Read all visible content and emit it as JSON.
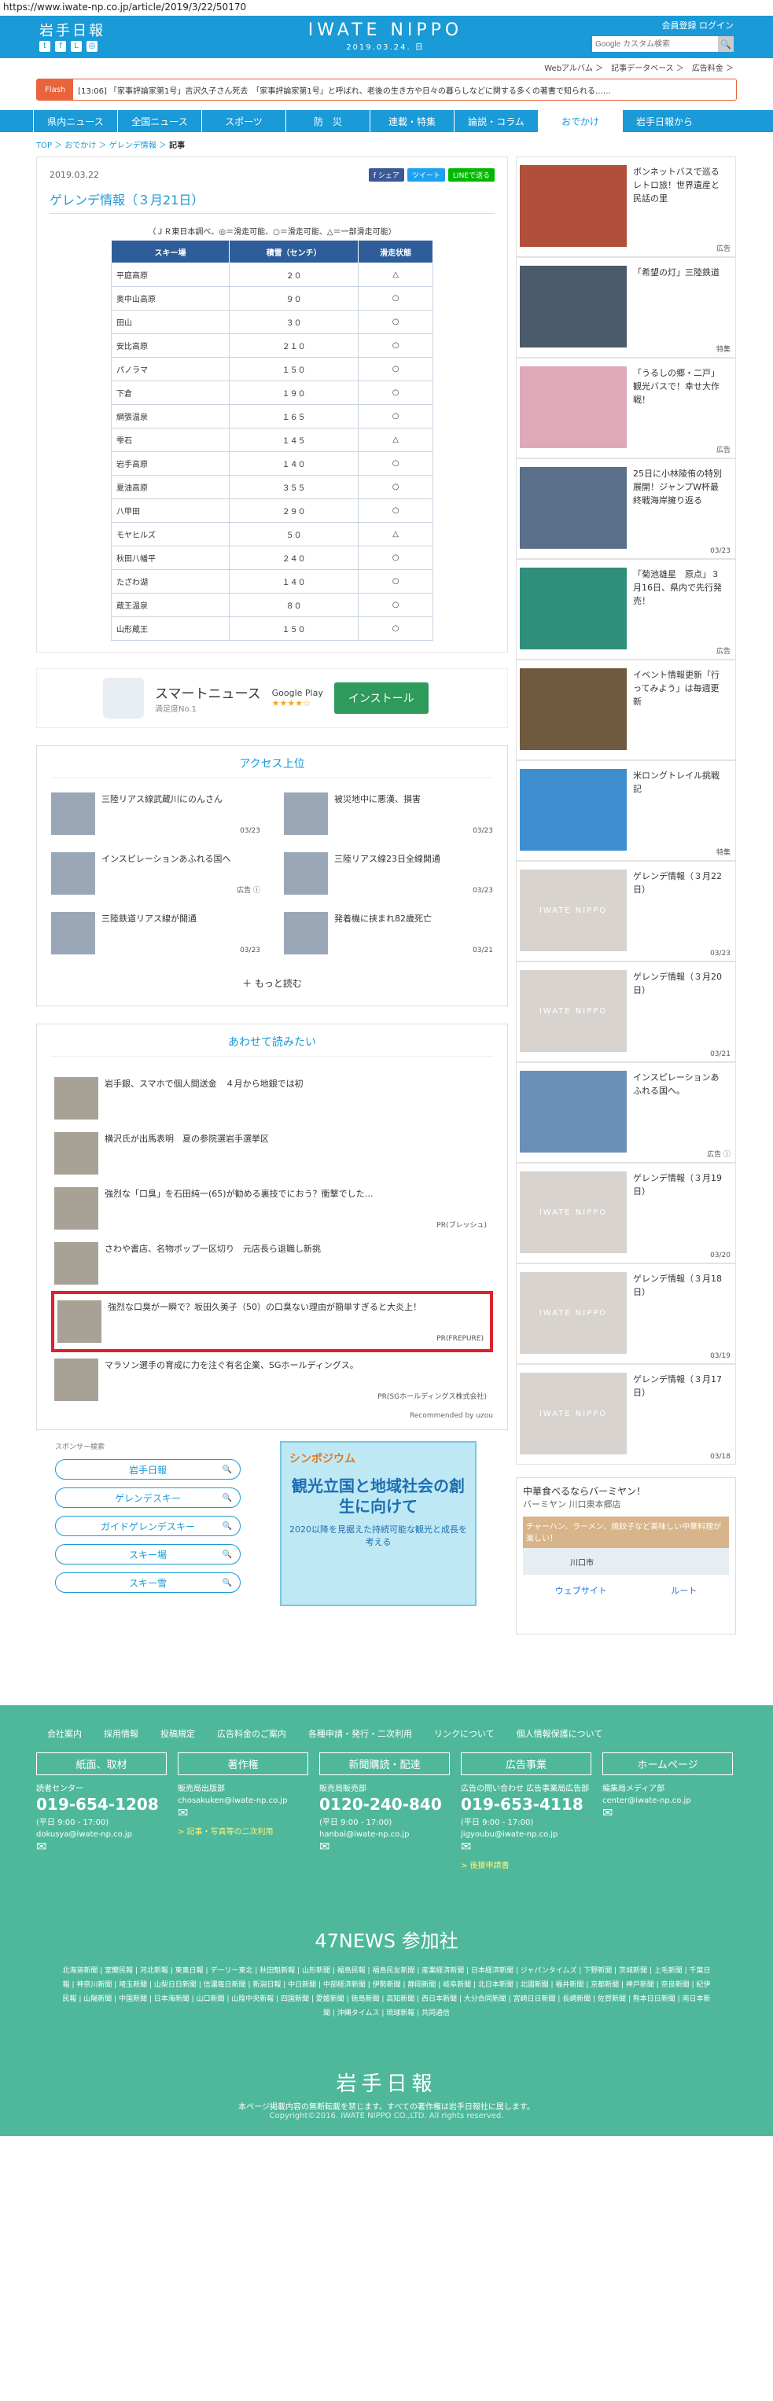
{
  "url": "https://www.iwate-np.co.jp/article/2019/3/22/50170",
  "header": {
    "logo": "岩手日報",
    "brand": "IWATE NIPPO",
    "date": "2019.03.24. 日",
    "links": "会員登録  ログイン",
    "search_placeholder": "Google カスタム検索",
    "search_btn": "🔍",
    "subbar": "Webアルバム ＞　記事データベース ＞　広告料金 ＞"
  },
  "flash": {
    "tag": "Flash",
    "text": "[13:06] 「家事評論家第1号」吉沢久子さん死去　「家事評論家第1号」と呼ばれ、老後の生き方や日々の暮らしなどに関する多くの著書で知られる……"
  },
  "nav": [
    "県内ニュース",
    "全国ニュース",
    "スポーツ",
    "防　災",
    "連載・特集",
    "論説・コラム",
    "おでかけ",
    "岩手日報から"
  ],
  "breadcrumb": {
    "items": "TOP ＞ おでかけ ＞ ゲレンデ情報 ＞",
    "current": "記事"
  },
  "article": {
    "date": "2019.03.22",
    "share": [
      "f シェア",
      "ツイート",
      "LINEで送る"
    ],
    "title": "ゲレンデ情報（３月21日）",
    "note": "（ＪＲ東日本調べ、◎＝滑走可能、○＝滑走可能、△＝一部滑走可能）",
    "table_headers": [
      "スキー場",
      "積雪（センチ）",
      "滑走状態"
    ],
    "rows": [
      [
        "平庭高原",
        "２０",
        "△"
      ],
      [
        "奥中山高原",
        "９０",
        "○"
      ],
      [
        "田山",
        "３０",
        "○"
      ],
      [
        "安比高原",
        "２１０",
        "○"
      ],
      [
        "パノラマ",
        "１５０",
        "○"
      ],
      [
        "下倉",
        "１９０",
        "○"
      ],
      [
        "網張温泉",
        "１６５",
        "○"
      ],
      [
        "雫石",
        "１４５",
        "△"
      ],
      [
        "岩手高原",
        "１４０",
        "○"
      ],
      [
        "夏油高原",
        "３５５",
        "○"
      ],
      [
        "八甲田",
        "２９０",
        "○"
      ],
      [
        "モヤヒルズ",
        "５０",
        "△"
      ],
      [
        "秋田八幡平",
        "２４０",
        "○"
      ],
      [
        "たざわ湖",
        "１４０",
        "○"
      ],
      [
        "蔵王温泉",
        "８０",
        "○"
      ],
      [
        "山形蔵王",
        "１５０",
        "○"
      ]
    ]
  },
  "app_ad": {
    "name": "スマートニュース",
    "sub": "満足度No.1",
    "store": "Google Play",
    "stars": "★★★★☆",
    "install": "インストール"
  },
  "access": {
    "title": "アクセス上位",
    "items": [
      {
        "title": "三陸リアス線武蔵川にのんさん",
        "date": "03/23"
      },
      {
        "title": "被災地中に悪漢、損害",
        "date": "03/23"
      },
      {
        "title": "インスピレーションあふれる国へ",
        "date": "広告 ⓘ"
      },
      {
        "title": "三陸リアス線23日全線開通",
        "date": "03/23"
      },
      {
        "title": "三陸鉄道リアス線が開通",
        "date": "03/23"
      },
      {
        "title": "発着機に挟まれ82歳死亡",
        "date": "03/21"
      }
    ],
    "more": "＋ もっと読む"
  },
  "related": {
    "title": "あわせて読みたい",
    "items": [
      {
        "title": "岩手銀、スマホで個人間送金　４月から地銀では初",
        "pr": ""
      },
      {
        "title": "横沢氏が出馬表明　夏の参院選岩手選挙区",
        "pr": ""
      },
      {
        "title": "強烈な「口臭」を石田純一(65)が勧める裏技でにおう？衝撃でした…",
        "pr": "PR(ブレッシュ)"
      },
      {
        "title": "さわや書店、名物ポップ一区切り　元店長ら退職し新挑",
        "pr": ""
      },
      {
        "title": "強烈な口臭が一瞬で？坂田久美子（50）の口臭ない理由が簡単すぎると大炎上！",
        "pr": "PR(FREPURE)"
      },
      {
        "title": "マラソン選手の育成に力を注ぐ有名企業、SGホールディングス。",
        "pr": "PR(SGホールディングス株式会社)"
      }
    ],
    "recby": "Recommended by uzou"
  },
  "sponsor": {
    "label": "スポンサー検索",
    "items": [
      "岩手日報",
      "ゲレンデスキー",
      "ガイドゲレンデスキー",
      "スキー場",
      "スキー雪"
    ]
  },
  "banner": {
    "top": "シンポジウム",
    "main": "観光立国と地域社会の創生に向けて",
    "sub": "2020以降を見据えた持続可能な観光と成長を考える"
  },
  "side": [
    {
      "title": "ボンネットバスで巡るレトロ旅！世界遺産と民話の里",
      "date": "広告",
      "np": false
    },
    {
      "title": "「希望の灯」三陸鉄道",
      "date": "特集",
      "np": false
    },
    {
      "title": "「うるしの郷・二戸」観光バスで！幸せ大作戦！",
      "date": "広告",
      "np": false
    },
    {
      "title": "25日に小林陵侑の特別展開！ジャンプW杯最終戦海岸擁り返る",
      "date": "03/23",
      "np": false
    },
    {
      "title": "「菊池雄星　原点」３月16日、県内で先行発売！",
      "date": "広告",
      "np": false
    },
    {
      "title": "イベント情報更新「行ってみよう」は毎週更新",
      "date": "",
      "np": false
    },
    {
      "title": "米ロングトレイル挑戦記",
      "date": "特集",
      "np": false
    },
    {
      "title": "ゲレンデ情報（３月22日）",
      "date": "03/23",
      "np": true
    },
    {
      "title": "ゲレンデ情報（３月20日）",
      "date": "03/21",
      "np": true
    },
    {
      "title": "インスピレーションあふれる国へ。",
      "date": "広告 ⓘ",
      "np": false
    },
    {
      "title": "ゲレンデ情報（３月19日）",
      "date": "03/20",
      "np": true
    },
    {
      "title": "ゲレンデ情報（３月18日）",
      "date": "03/19",
      "np": true
    },
    {
      "title": "ゲレンデ情報（３月17日）",
      "date": "03/18",
      "np": true
    }
  ],
  "np_placeholder": "IWATE NIPPO",
  "map_ad": {
    "head": "中華食べるならバーミヤン！",
    "sub": "バーミヤン 川口東本郷店",
    "pic": "チャーハン、ラーメン、焼餃子など美味しい中華料理が楽しい！",
    "map": "川口市",
    "route1": "ウェブサイト",
    "route2": "ルート"
  },
  "footer": {
    "links": [
      "会社案内",
      "採用情報",
      "投稿規定",
      "広告料金のご案内",
      "各種申請・発行・二次利用",
      "リンクについて",
      "個人情報保護について"
    ],
    "cols": [
      {
        "head": "紙面、取材",
        "l1": "読者センター",
        "tel": "019-654-1208",
        "l2": "(平日 9:00 - 17:00)",
        "mail": "dokusya@iwate-np.co.jp",
        "lnk": ""
      },
      {
        "head": "著作権",
        "l1": "販売局出版部",
        "tel": "",
        "l2": "",
        "mail": "chosakuken@iwate-np.co.jp",
        "lnk": "> 記事・写真等の二次利用"
      },
      {
        "head": "新聞購読・配達",
        "l1": "販売局販売部",
        "tel": "0120-240-840",
        "l2": "(平日 9:00 - 17:00)",
        "mail": "hanbai@iwate-np.co.jp",
        "lnk": ""
      },
      {
        "head": "広告事業",
        "l1": "広告の問い合わせ 広告事業局広告部",
        "tel": "019-653-4118",
        "l2": "(平日 9:00 - 17:00)",
        "mail": "jigyoubu@iwate-np.co.jp",
        "lnk": "> 後援申請書"
      },
      {
        "head": "ホームページ",
        "l1": "編集局メディア部",
        "tel": "",
        "l2": "",
        "mail": "center@iwate-np.co.jp",
        "lnk": ""
      }
    ],
    "news47": "47NEWS 参加社",
    "papers": "北海道新聞 | 室蘭民報 | 河北新報 | 東奥日報 | デーリー東北 | 秋田魁新報 | 山形新聞 | 福島民報 | 福島民友新聞 | 産業経済新聞 | 日本経済新聞 | ジャパンタイムズ | 下野新聞 | 茨城新聞 | 上毛新聞 | 千葉日報 | 神奈川新聞 | 埼玉新聞 | 山梨日日新聞 | 信濃毎日新聞 | 新潟日報 | 中日新聞 | 中部経済新聞 | 伊勢新聞 | 静岡新聞 | 岐阜新聞 | 北日本新聞 | 北國新聞 | 福井新聞 | 京都新聞 | 神戸新聞 | 奈良新聞 | 紀伊民報 | 山陽新聞 | 中国新聞 | 日本海新聞 | 山口新聞 | 山陰中央新報 | 四国新聞 | 愛媛新聞 | 徳島新聞 | 高知新聞 | 西日本新聞 | 大分合同新聞 | 宮崎日日新聞 | 長崎新聞 | 佐賀新聞 | 熊本日日新聞 | 南日本新聞 | 沖縄タイムス | 琉球新報 | 共同通信",
    "logo": "岩手日報",
    "copy": "本ページ掲載内容の無断転載を禁じます。すべての著作権は岩手日報社に属します。",
    "copy2": "Copyright©2016. IWATE NIPPO CO.,LTD. All rights reserved."
  }
}
